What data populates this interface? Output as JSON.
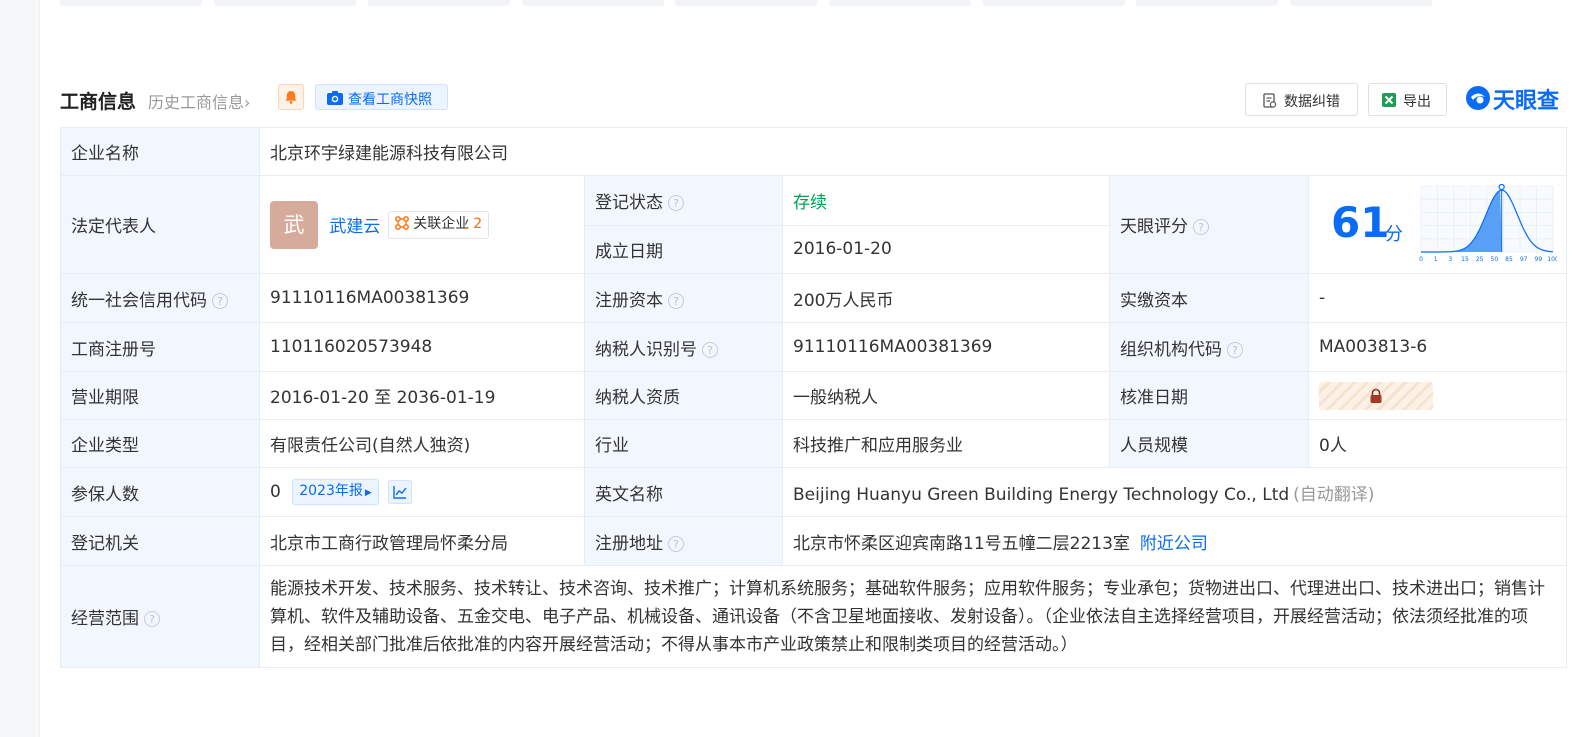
{
  "header": {
    "title": "工商信息",
    "history_link": "历史工商信息",
    "history_chevron": "›",
    "bell_icon": "bell-icon",
    "snapshot_button": "查看工商快照",
    "data_correction_button": "数据纠错",
    "export_button": "导出",
    "brand": "天眼查"
  },
  "colors": {
    "accent_blue": "#0a6cf2",
    "label_bg": "#f2f7ff",
    "status_green": "#00a352",
    "orange": "#ff6a00"
  },
  "labels": {
    "company_name": "企业名称",
    "legal_rep": "法定代表人",
    "reg_status": "登记状态",
    "founded_date": "成立日期",
    "tianyan_score": "天眼评分",
    "credit_code": "统一社会信用代码",
    "reg_capital": "注册资本",
    "paid_capital": "实缴资本",
    "reg_number": "工商注册号",
    "taxpayer_id": "纳税人识别号",
    "org_code": "组织机构代码",
    "business_term": "营业期限",
    "taxpayer_qualification": "纳税人资质",
    "approval_date": "核准日期",
    "company_type": "企业类型",
    "industry": "行业",
    "staff_size": "人员规模",
    "insured_count": "参保人数",
    "english_name": "英文名称",
    "reg_authority": "登记机关",
    "reg_address": "注册地址",
    "business_scope": "经营范围"
  },
  "values": {
    "company_name": "北京环宇绿建能源科技有限公司",
    "legal_rep_avatar": "武",
    "legal_rep_name": "武建云",
    "related_companies_label": "关联企业",
    "related_companies_count": "2",
    "reg_status": "存续",
    "founded_date": "2016-01-20",
    "score": "61",
    "score_unit": "分",
    "credit_code": "91110116MA00381369",
    "reg_capital": "200万人民币",
    "paid_capital": "-",
    "reg_number": "110116020573948",
    "taxpayer_id": "91110116MA00381369",
    "org_code": "MA003813-6",
    "business_term": "2016-01-20 至 2036-01-19",
    "taxpayer_qualification": "一般纳税人",
    "company_type": "有限责任公司(自然人独资)",
    "industry": "科技推广和应用服务业",
    "staff_size": "0人",
    "insured_count": "0",
    "report_year": "2023年报",
    "english_name": "Beijing Huanyu Green Building Energy Technology Co., Ltd",
    "auto_translate": "(自动翻译)",
    "reg_authority": "北京市工商行政管理局怀柔分局",
    "reg_address": "北京市怀柔区迎宾南路11号五幢二层2213室",
    "nearby_companies": "附近公司",
    "business_scope": "能源技术开发、技术服务、技术转让、技术咨询、技术推广；计算机系统服务；基础软件服务；应用软件服务；专业承包；货物进出口、代理进出口、技术进出口；销售计算机、软件及辅助设备、五金交电、电子产品、机械设备、通讯设备（不含卫星地面接收、发射设备）。（企业依法自主选择经营项目，开展经营活动；依法须经批准的项目，经相关部门批准后依批准的内容开展经营活动；不得从事本市产业政策禁止和限制类项目的经营活动。）"
  },
  "score_chart": {
    "x_ticks": [
      "0",
      "1",
      "3",
      "15",
      "25",
      "50",
      "85",
      "97",
      "99",
      "100"
    ],
    "marker_value": 61
  },
  "help_glyph": "?"
}
